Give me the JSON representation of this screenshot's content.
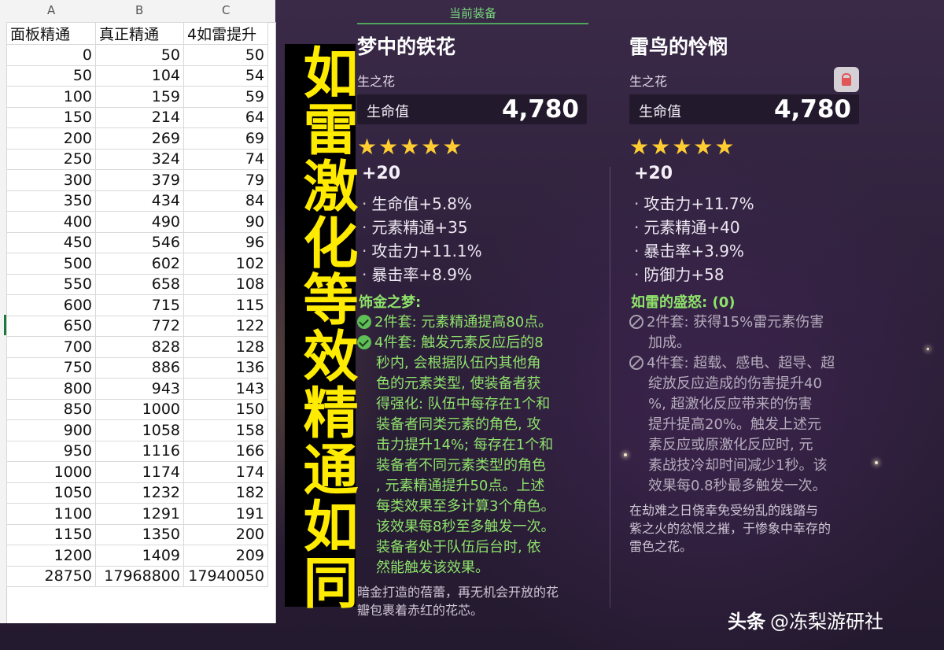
{
  "sheet": {
    "col_letters": [
      "A",
      "B",
      "C"
    ],
    "headers": [
      "面板精通",
      "真正精通",
      "4如雷提升"
    ],
    "rows": [
      [
        "0",
        "50",
        "50"
      ],
      [
        "50",
        "104",
        "54"
      ],
      [
        "100",
        "159",
        "59"
      ],
      [
        "150",
        "214",
        "64"
      ],
      [
        "200",
        "269",
        "69"
      ],
      [
        "250",
        "324",
        "74"
      ],
      [
        "300",
        "379",
        "79"
      ],
      [
        "350",
        "434",
        "84"
      ],
      [
        "400",
        "490",
        "90"
      ],
      [
        "450",
        "546",
        "96"
      ],
      [
        "500",
        "602",
        "102"
      ],
      [
        "550",
        "658",
        "108"
      ],
      [
        "600",
        "715",
        "115"
      ],
      [
        "650",
        "772",
        "122"
      ],
      [
        "700",
        "828",
        "128"
      ],
      [
        "750",
        "886",
        "136"
      ],
      [
        "800",
        "943",
        "143"
      ],
      [
        "850",
        "1000",
        "150"
      ],
      [
        "900",
        "1058",
        "158"
      ],
      [
        "950",
        "1116",
        "166"
      ],
      [
        "1000",
        "1174",
        "174"
      ],
      [
        "1050",
        "1232",
        "182"
      ],
      [
        "1100",
        "1291",
        "191"
      ],
      [
        "1150",
        "1350",
        "200"
      ],
      [
        "1200",
        "1409",
        "209"
      ],
      [
        "28750",
        "17968800",
        "17940050"
      ]
    ]
  },
  "overlay_title": "如雷激化等效精通如同",
  "left_card": {
    "equip_tag": "当前装备",
    "name": "梦中的铁花",
    "slot": "生之花",
    "main_stat_label": "生命值",
    "main_stat_value": "4,780",
    "stars": "★★★★★",
    "level": "+20",
    "substats": [
      "生命值+5.8%",
      "元素精通+35",
      "攻击力+11.1%",
      "暴击率+8.9%"
    ],
    "set_name": "饰金之梦:",
    "effects": [
      {
        "lines": [
          "2件套: 元素精通提高80点。"
        ]
      },
      {
        "lines": [
          "4件套: 触发元素反应后的8",
          "秒内, 会根据队伍内其他角",
          "色的元素类型, 使装备者获",
          "得强化: 队伍中每存在1个和",
          "装备者同类元素的角色, 攻",
          "击力提升14%; 每存在1个和",
          "装备者不同元素类型的角色",
          ", 元素精通提升50点。上述",
          "每类效果至多计算3个角色。",
          "该效果每8秒至多触发一次。",
          "装备者处于队伍后台时, 依",
          "然能触发该效果。"
        ]
      }
    ],
    "description": "暗金打造的蓓蕾，再无机会开放的花瓣包裹着赤红的花芯。",
    "desc_lines": [
      "暗金打造的蓓蕾，再无机会开放的花",
      "瓣包裹着赤红的花芯。"
    ]
  },
  "right_card": {
    "name": "雷鸟的怜悯",
    "slot": "生之花",
    "lock_icon": "lock-icon",
    "main_stat_label": "生命值",
    "main_stat_value": "4,780",
    "stars": "★★★★★",
    "level": "+20",
    "substats": [
      "攻击力+11.7%",
      "元素精通+40",
      "暴击率+3.9%",
      "防御力+58"
    ],
    "set_name": "如雷的盛怒: (0)",
    "effects": [
      {
        "lines": [
          "2件套: 获得15%雷元素伤害",
          "加成。"
        ]
      },
      {
        "lines": [
          "4件套: 超载、感电、超导、超",
          "绽放反应造成的伤害提升40",
          "%, 超激化反应带来的伤害",
          "提升提高20%。触发上述元",
          "素反应或原激化反应时, 元",
          "素战技冷却时间减少1秒。该",
          "效果每0.8秒最多触发一次。"
        ]
      }
    ],
    "desc_lines": [
      "在劫难之日侥幸免受纷乱的践踏与",
      "紫之火的忿恨之摧，于惨象中幸存的",
      "雷色之花。"
    ]
  },
  "watermark": {
    "brand": "头条",
    "handle": "@冻梨游研社"
  },
  "colors": {
    "title_yellow": "#ffeb00",
    "set_green": "#8ee36a",
    "star_gold": "#ffcc32"
  }
}
